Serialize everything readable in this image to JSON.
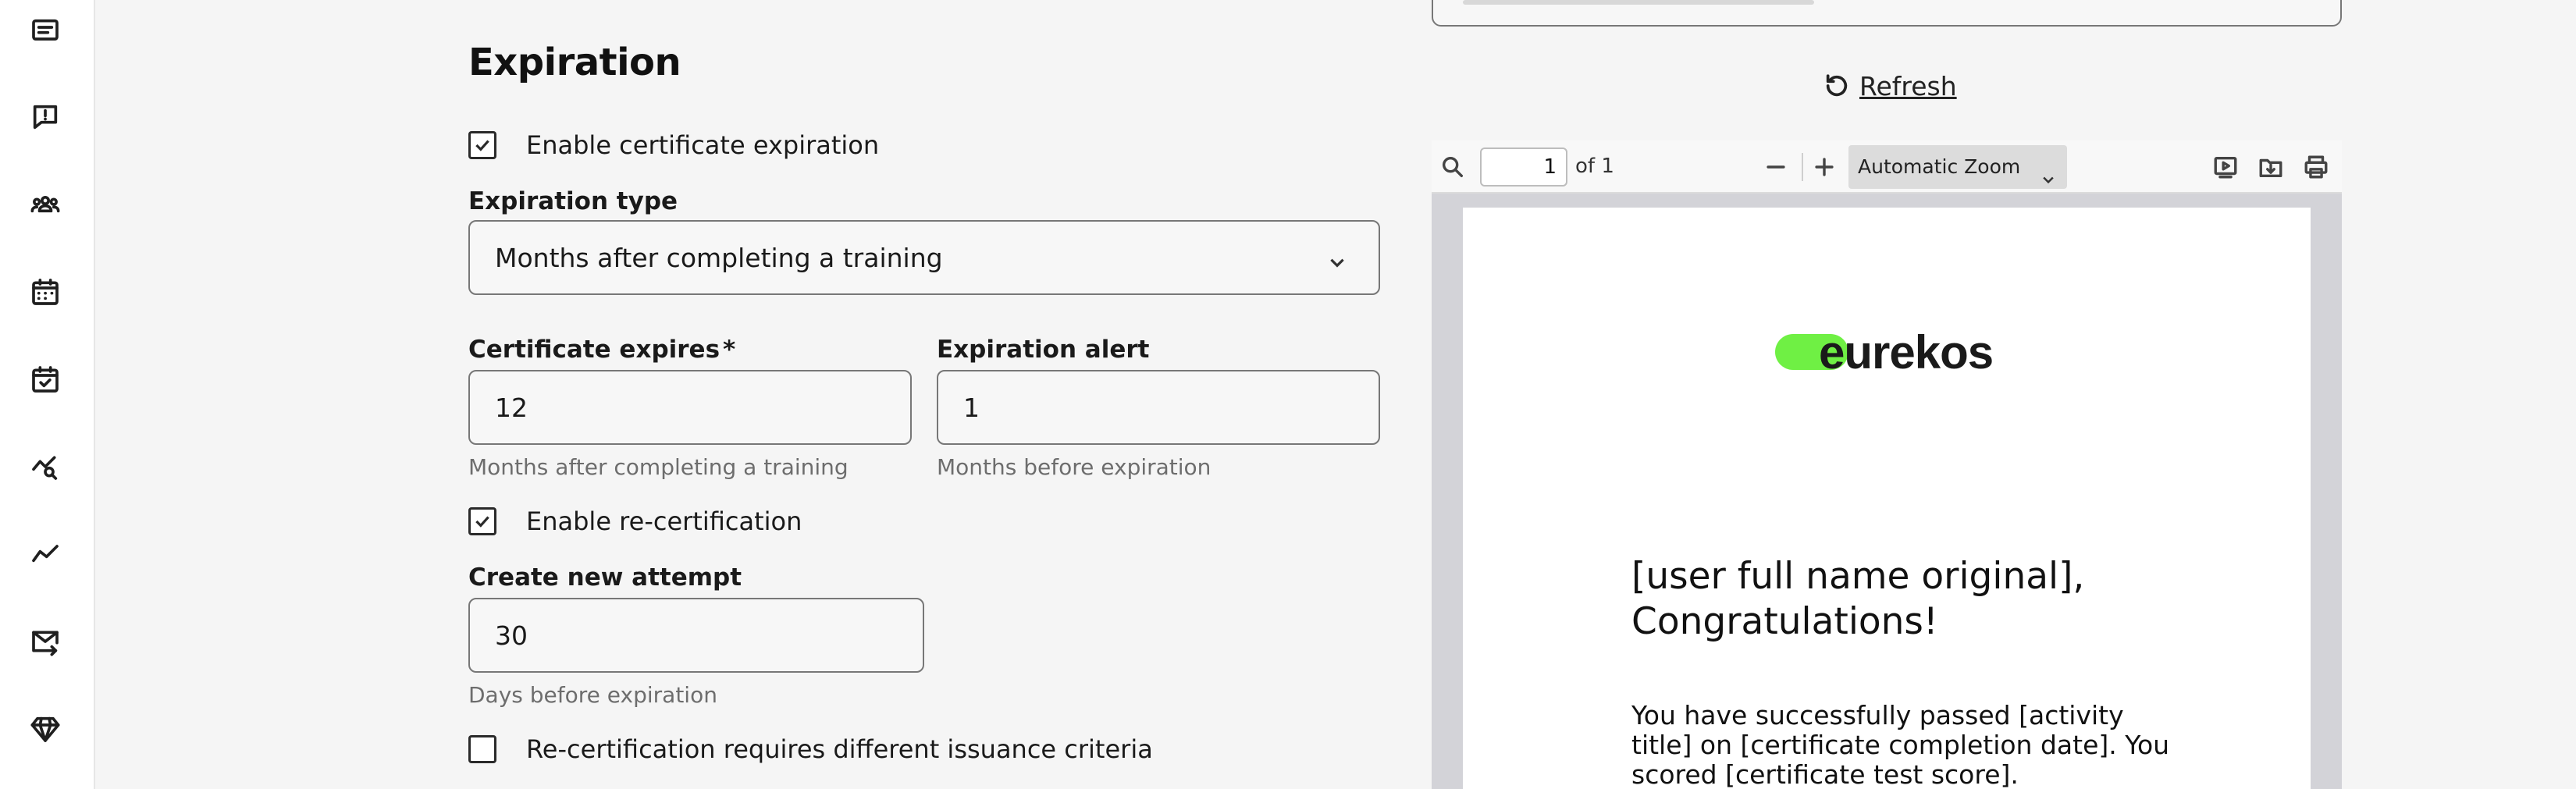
{
  "sidebar": {
    "icons": [
      "presentation-icon",
      "feedback-icon",
      "users-icon",
      "calendar-icon",
      "calendar-check-icon",
      "analytics-search-icon",
      "trend-icon",
      "mail-send-icon",
      "diamond-icon"
    ]
  },
  "expiration": {
    "title": "Expiration",
    "enable_expiration_label": "Enable certificate expiration",
    "enable_expiration_checked": true,
    "expiration_type_label": "Expiration type",
    "expiration_type_value": "Months after completing a training",
    "certificate_expires_label": "Certificate expires",
    "required_mark": "*",
    "certificate_expires_value": "12",
    "certificate_expires_hint": "Months after completing a training",
    "expiration_alert_label": "Expiration alert",
    "expiration_alert_value": "1",
    "expiration_alert_hint": "Months before expiration",
    "enable_recert_label": "Enable re-certification",
    "enable_recert_checked": true,
    "create_attempt_label": "Create new attempt",
    "create_attempt_value": "30",
    "create_attempt_hint": "Days before expiration",
    "different_criteria_label": "Re-certification requires different issuance criteria",
    "different_criteria_checked": false
  },
  "preview": {
    "refresh_label": "Refresh",
    "page_number": "1",
    "page_of": "of 1",
    "zoom_value": "Automatic Zoom",
    "logo_text": "eurekos",
    "heading": "[user full name original], Congratulations!",
    "body": "You have successfully passed [activity title] on [certificate completion date]. You scored [certificate test score]."
  },
  "colors": {
    "logo_green": "#6ff044",
    "pdf_background": "#d3d3d8"
  }
}
